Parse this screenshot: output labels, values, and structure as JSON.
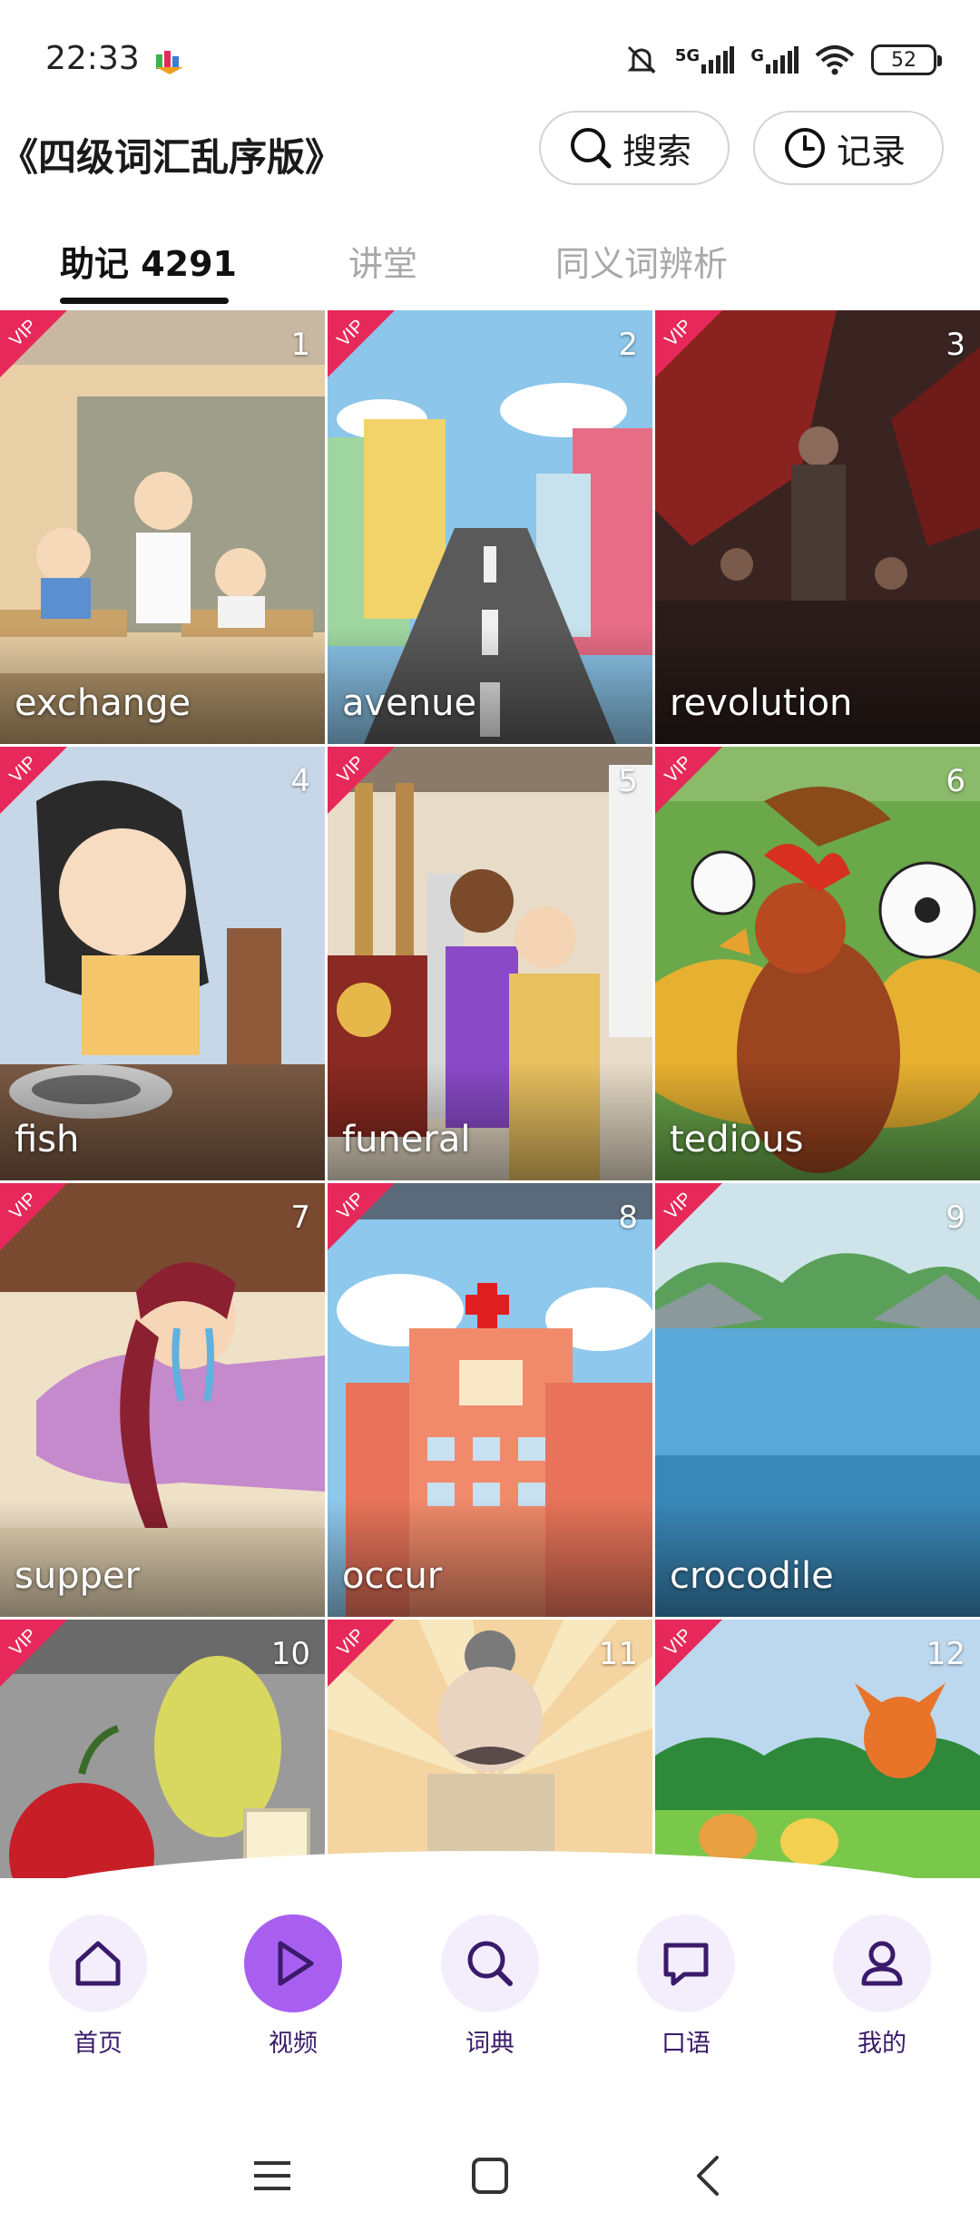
{
  "status_bar": {
    "time": "22:33",
    "network_1": "5G",
    "network_2": "G",
    "battery": "52"
  },
  "header": {
    "title": "《四级词汇乱序版》",
    "search_label": "搜索",
    "record_label": "记录"
  },
  "tabs": [
    {
      "label": "助记 4291",
      "active": true
    },
    {
      "label": "讲堂",
      "active": false
    },
    {
      "label": "同义词辨析",
      "active": false
    }
  ],
  "videos": [
    {
      "number": "1",
      "word": "exchange",
      "vip": "VIP"
    },
    {
      "number": "2",
      "word": "avenue",
      "vip": "VIP"
    },
    {
      "number": "3",
      "word": "revolution",
      "vip": "VIP"
    },
    {
      "number": "4",
      "word": "fish",
      "vip": "VIP"
    },
    {
      "number": "5",
      "word": "funeral",
      "vip": "VIP"
    },
    {
      "number": "6",
      "word": "tedious",
      "vip": "VIP"
    },
    {
      "number": "7",
      "word": "supper",
      "vip": "VIP"
    },
    {
      "number": "8",
      "word": "occur",
      "vip": "VIP"
    },
    {
      "number": "9",
      "word": "crocodile",
      "vip": "VIP"
    },
    {
      "number": "10",
      "word": "",
      "vip": "VIP"
    },
    {
      "number": "11",
      "word": "",
      "vip": "VIP"
    },
    {
      "number": "12",
      "word": "",
      "vip": "VIP"
    }
  ],
  "bottom_nav": [
    {
      "label": "首页",
      "icon": "home-icon",
      "active": false
    },
    {
      "label": "视频",
      "icon": "play-icon",
      "active": true
    },
    {
      "label": "词典",
      "icon": "search-icon",
      "active": false
    },
    {
      "label": "口语",
      "icon": "chat-icon",
      "active": false
    },
    {
      "label": "我的",
      "icon": "profile-icon",
      "active": false
    }
  ],
  "colors": {
    "accent": "#a85ff0",
    "accent_dark": "#3a1a6a",
    "vip": "#e6295a"
  }
}
